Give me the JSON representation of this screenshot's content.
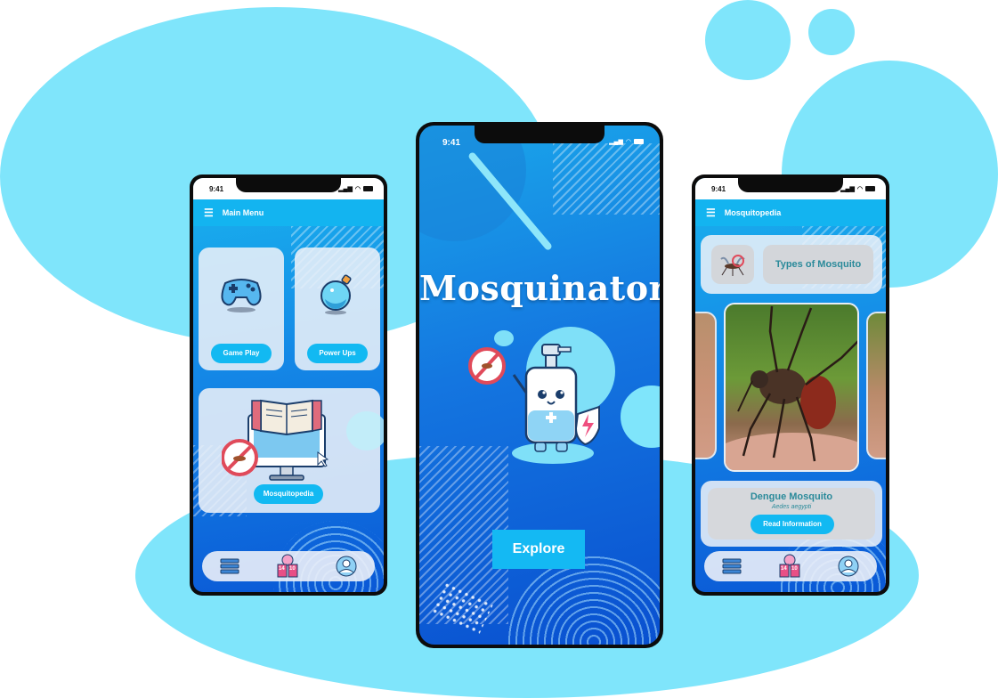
{
  "colors": {
    "accent": "#13b4f0",
    "blob": "#7fe5fb",
    "deep_blue": "#0a58d6"
  },
  "left_phone": {
    "status_time": "9:41",
    "header_title": "Main Menu",
    "cards": [
      {
        "label": "Game Play",
        "icon": "gamepad-icon"
      },
      {
        "label": "Power Ups",
        "icon": "potion-icon"
      },
      {
        "label": "Mosquitopedia",
        "icon": "computer-book-icon"
      }
    ],
    "nav": [
      {
        "icon": "list-icon"
      },
      {
        "icon": "leaderboard-icon",
        "numbers": [
          "14",
          "10"
        ]
      },
      {
        "icon": "profile-icon"
      }
    ]
  },
  "center_phone": {
    "status_time": "9:41",
    "title": "Mosquinator",
    "button_label": "Explore",
    "mascot": "spray-bottle-mascot-icon"
  },
  "right_phone": {
    "status_time": "9:41",
    "header_title": "Mosquitopedia",
    "category_label": "Types of Mosquito",
    "mosquito_name": "Dengue Mosquito",
    "scientific_name": "Aedes aegypti",
    "button_label": "Read Information",
    "nav": [
      {
        "icon": "list-icon"
      },
      {
        "icon": "leaderboard-icon",
        "numbers": [
          "14",
          "10"
        ]
      },
      {
        "icon": "profile-icon"
      }
    ]
  }
}
